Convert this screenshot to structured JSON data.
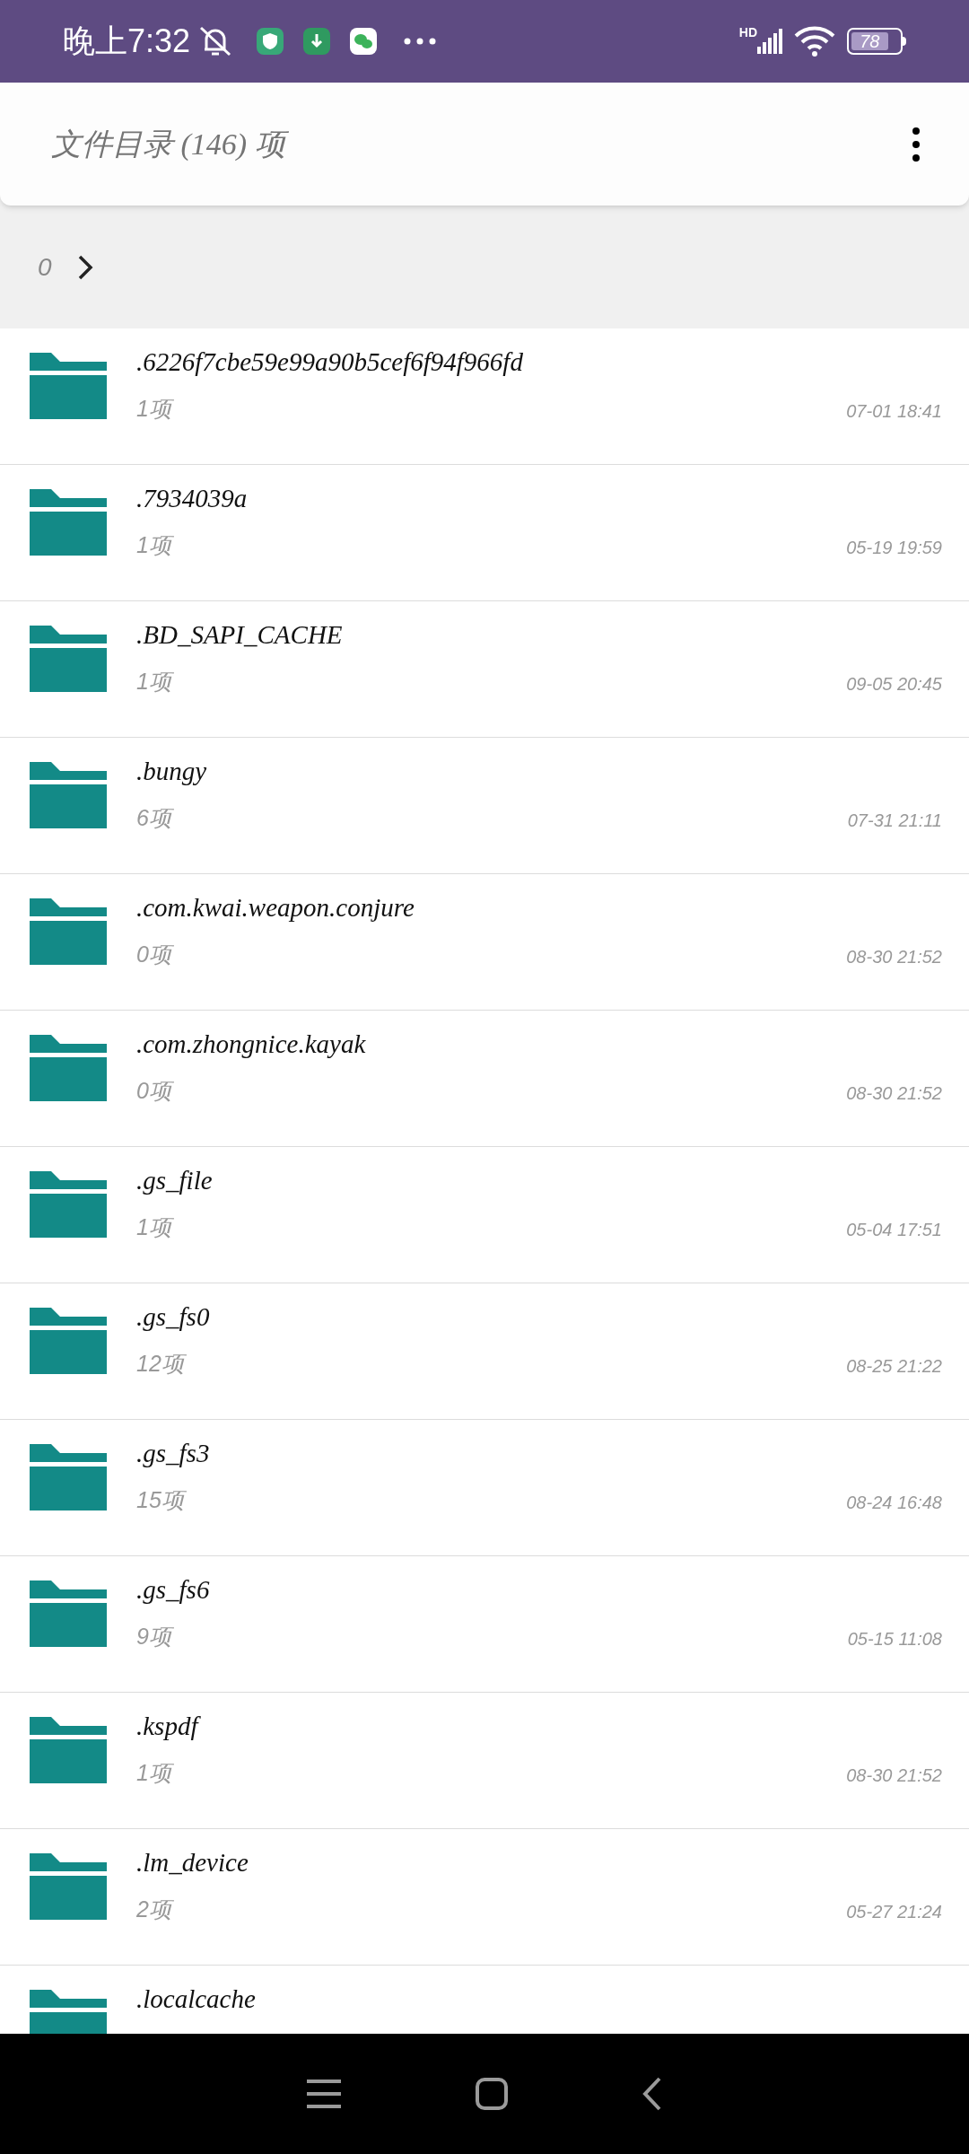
{
  "status_bar": {
    "time": "晚上7:32",
    "network": "HD",
    "battery": "78"
  },
  "header": {
    "title": "文件目录 (146) 项"
  },
  "breadcrumb": {
    "path": "0"
  },
  "folders": [
    {
      "name": ".6226f7cbe59e99a90b5cef6f94f966fd",
      "count": "1项",
      "modified": "07-01 18:41"
    },
    {
      "name": ".7934039a",
      "count": "1项",
      "modified": "05-19 19:59"
    },
    {
      "name": ".BD_SAPI_CACHE",
      "count": "1项",
      "modified": "09-05 20:45"
    },
    {
      "name": ".bungy",
      "count": "6项",
      "modified": "07-31 21:11"
    },
    {
      "name": ".com.kwai.weapon.conjure",
      "count": "0项",
      "modified": "08-30 21:52"
    },
    {
      "name": ".com.zhongnice.kayak",
      "count": "0项",
      "modified": "08-30 21:52"
    },
    {
      "name": ".gs_file",
      "count": "1项",
      "modified": "05-04 17:51"
    },
    {
      "name": ".gs_fs0",
      "count": "12项",
      "modified": "08-25 21:22"
    },
    {
      "name": ".gs_fs3",
      "count": "15项",
      "modified": "08-24 16:48"
    },
    {
      "name": ".gs_fs6",
      "count": "9项",
      "modified": "05-15 11:08"
    },
    {
      "name": ".kspdf",
      "count": "1项",
      "modified": "08-30 21:52"
    },
    {
      "name": ".lm_device",
      "count": "2项",
      "modified": "05-27 21:24"
    },
    {
      "name": ".localcache"
    }
  ]
}
